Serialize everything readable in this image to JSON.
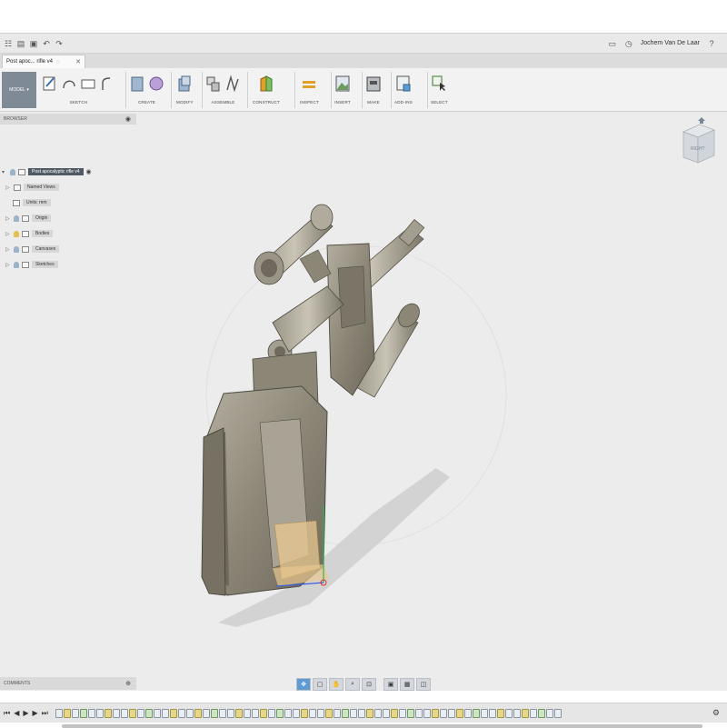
{
  "app": {
    "user_name": "Jochem Van De Laar",
    "document_tab": "Post apoc... rifle v4"
  },
  "toolbar": {
    "mode": "MODEL",
    "groups": [
      {
        "label": "SKETCH"
      },
      {
        "label": "CREATE"
      },
      {
        "label": "MODIFY"
      },
      {
        "label": "ASSEMBLE"
      },
      {
        "label": "CONSTRUCT"
      },
      {
        "label": "INSPECT"
      },
      {
        "label": "INSERT"
      },
      {
        "label": "MAKE"
      },
      {
        "label": "ADD-INS"
      },
      {
        "label": "SELECT"
      }
    ]
  },
  "browser": {
    "title": "BROWSER",
    "root": "Post apocalyptic rifle v4",
    "items": [
      {
        "label": "Named Views"
      },
      {
        "label": "Units: mm"
      },
      {
        "label": "Origin"
      },
      {
        "label": "Bodies"
      },
      {
        "label": "Canvases"
      },
      {
        "label": "Sketches"
      }
    ]
  },
  "viewcube": {
    "face": "RIGHT"
  },
  "comments": {
    "title": "COMMENTS"
  },
  "timeline": {
    "feature_count": 62
  },
  "colors": {
    "accent": "#5e9bd5",
    "model_body": "#8c8677",
    "sketch_fill": "#e8c88f"
  }
}
